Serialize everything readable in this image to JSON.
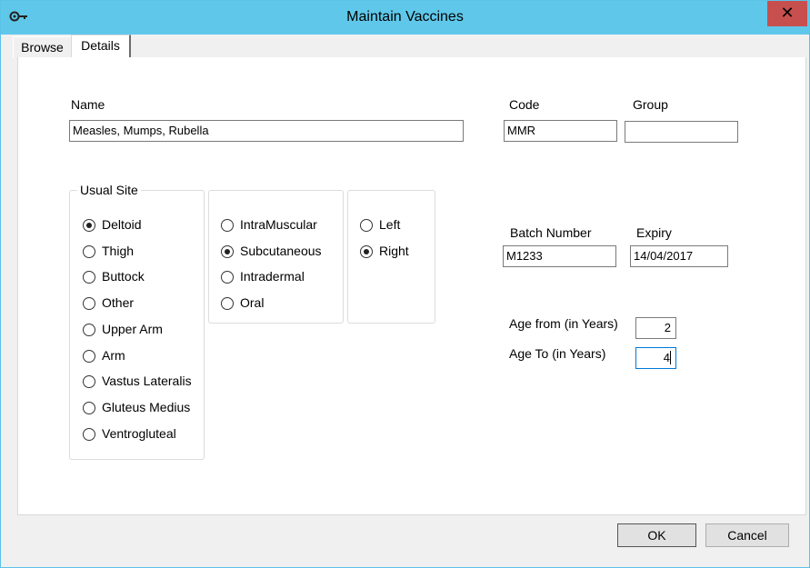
{
  "window": {
    "title": "Maintain Vaccines",
    "close_glyph": "✕"
  },
  "tabs": [
    {
      "label": "Browse"
    },
    {
      "label": "Details"
    }
  ],
  "form": {
    "name": {
      "label": "Name",
      "value": "Measles, Mumps, Rubella"
    },
    "code": {
      "label": "Code",
      "value": "MMR"
    },
    "group": {
      "label": "Group",
      "value": ""
    },
    "batch_number": {
      "label": "Batch Number",
      "value": "M1233"
    },
    "expiry": {
      "label": "Expiry",
      "value": "14/04/2017"
    },
    "age_from": {
      "label": "Age from (in Years)",
      "value": "2"
    },
    "age_to": {
      "label": "Age To (in Years)",
      "value": "4"
    }
  },
  "usual_site": {
    "caption": "Usual Site",
    "sites": [
      {
        "label": "Deltoid",
        "checked": true
      },
      {
        "label": "Thigh",
        "checked": false
      },
      {
        "label": "Buttock",
        "checked": false
      },
      {
        "label": "Other",
        "checked": false
      },
      {
        "label": "Upper Arm",
        "checked": false
      },
      {
        "label": "Arm",
        "checked": false
      },
      {
        "label": "Vastus Lateralis",
        "checked": false
      },
      {
        "label": "Gluteus Medius",
        "checked": false
      },
      {
        "label": "Ventrogluteal",
        "checked": false
      }
    ],
    "routes": [
      {
        "label": "IntraMuscular",
        "checked": false
      },
      {
        "label": "Subcutaneous",
        "checked": true
      },
      {
        "label": "Intradermal",
        "checked": false
      },
      {
        "label": "Oral",
        "checked": false
      }
    ],
    "sides": [
      {
        "label": "Left",
        "checked": false
      },
      {
        "label": "Right",
        "checked": true
      }
    ]
  },
  "buttons": {
    "ok": "OK",
    "cancel": "Cancel"
  },
  "icons": {
    "app": "key-icon",
    "close": "close-icon"
  },
  "colors": {
    "titlebar": "#5fc8ea",
    "close": "#c7504f",
    "focus_border": "#0078d7"
  }
}
